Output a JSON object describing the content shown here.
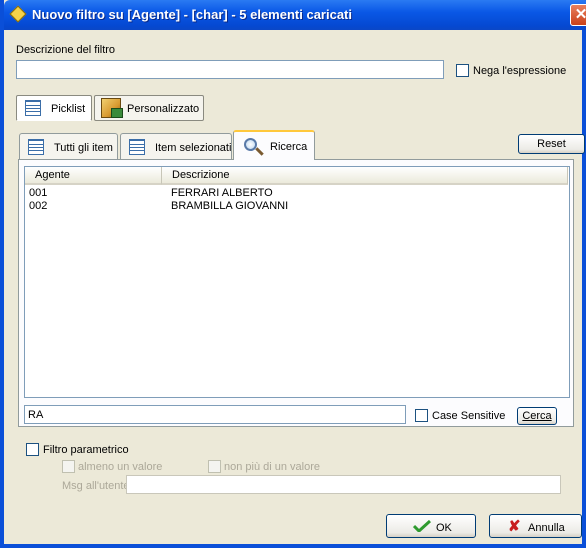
{
  "window": {
    "title": "Nuovo filtro su [Agente] - [char] - 5 elementi caricati",
    "close_glyph": "✕"
  },
  "filter_description": {
    "label": "Descrizione del filtro",
    "value": ""
  },
  "negate": {
    "label": "Nega l'espressione",
    "checked": false
  },
  "mode_tabs": [
    {
      "label": "Picklist",
      "icon": "list-icon",
      "active": true
    },
    {
      "label": "Personalizzato",
      "icon": "custom-filter-icon",
      "active": false
    }
  ],
  "view_tabs": [
    {
      "label": "Tutti gli item",
      "icon": "list-icon",
      "active": false
    },
    {
      "label": "Item selezionati",
      "icon": "list-icon",
      "active": false
    },
    {
      "label": "Ricerca",
      "icon": "magnifier-icon",
      "active": true
    }
  ],
  "reset_label": "Reset",
  "table": {
    "columns": [
      "Agente",
      "Descrizione"
    ],
    "rows": [
      {
        "code": "001",
        "description": "FERRARI ALBERTO"
      },
      {
        "code": "002",
        "description": "BRAMBILLA GIOVANNI"
      }
    ]
  },
  "search": {
    "value": "RA",
    "case_sensitive_label": "Case Sensitive",
    "case_sensitive_checked": false,
    "button_label": "Cerca"
  },
  "parametric": {
    "label": "Filtro parametrico",
    "at_least_one_label": "almeno un valore",
    "at_most_one_label": "non più di un valore",
    "user_message_label": "Msg all'utente",
    "user_message_value": ""
  },
  "footer": {
    "ok_label": "OK",
    "cancel_label": "Annulla"
  },
  "colors": {
    "titlebar": "#0a58e6",
    "dialog_bg": "#ece9d8",
    "active_tab_accent": "#ffc83c",
    "ok_check": "#2e9a2e",
    "cancel_x": "#c81e1e"
  }
}
